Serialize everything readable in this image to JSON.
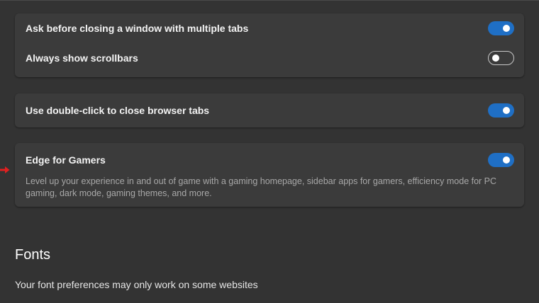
{
  "settings": {
    "group1": {
      "ask_close_label": "Ask before closing a window with multiple tabs",
      "ask_close_state": "on",
      "scrollbars_label": "Always show scrollbars",
      "scrollbars_state": "off"
    },
    "group2": {
      "double_click_label": "Use double-click to close browser tabs",
      "double_click_state": "on"
    },
    "gamers": {
      "title": "Edge for Gamers",
      "description": "Level up your experience in and out of game with a gaming homepage, sidebar apps for gamers, efficiency mode for PC gaming, dark mode, gaming themes, and more.",
      "state": "on"
    }
  },
  "fonts": {
    "title": "Fonts",
    "subtitle": "Your font preferences may only work on some websites"
  },
  "icons": {
    "pointer_arrow": "red-arrow-icon"
  },
  "colors": {
    "background": "#333333",
    "card": "#3b3b3b",
    "toggle_on": "#1f6fc5",
    "arrow": "#e02020"
  }
}
